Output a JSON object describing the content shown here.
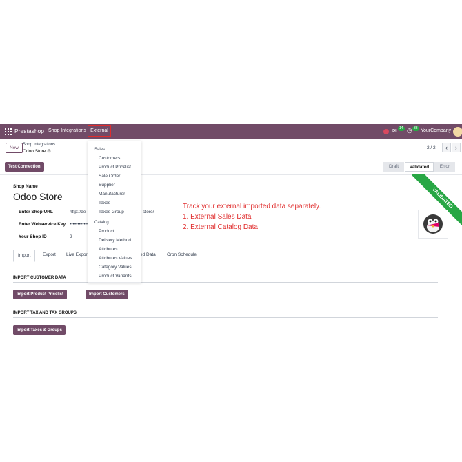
{
  "navbar": {
    "brand": "Prestashop",
    "menu_shop_integrations": "Shop Integrations",
    "menu_external": "External",
    "chat_badge": "14",
    "activity_badge": "33",
    "company": "YourCompany"
  },
  "control_panel": {
    "new_label": "New",
    "breadcrumb_parent": "Shop Integrations",
    "breadcrumb_current": "Odoo Store",
    "pager": "2 / 2"
  },
  "button_bar": {
    "test_connection": "Test Connection",
    "statuses": [
      "Draft",
      "Validated",
      "Error"
    ]
  },
  "sheet": {
    "shop_name_label": "Shop Name",
    "shop_name": "Odoo Store",
    "ribbon": "VALIDATED",
    "fields": [
      {
        "label": "Enter Shop URL",
        "value": "http://de",
        "value_tail": "-store/"
      },
      {
        "label": "Enter Webservice Key",
        "value": "••••••••••••"
      },
      {
        "label": "Your Shop ID",
        "value": "2"
      }
    ]
  },
  "annotation": {
    "line1": "Track your external imported data separately.",
    "line2": "1. External Sales Data",
    "line3": "2. External Catalog Data"
  },
  "tabs": [
    "Import",
    "Export",
    "Live Expor",
    "ed Data",
    "Cron Schedule"
  ],
  "import_section": {
    "customer_heading": "IMPORT CUSTOMER DATA",
    "btn_pricelist": "Import Product Pricelist",
    "btn_customers": "Import Customers",
    "tax_heading": "IMPORT TAX AND TAX GROUPS",
    "btn_taxes": "Import Taxes & Groups"
  },
  "dropdown": {
    "sales_heading": "Sales",
    "sales_items": [
      "Customers",
      "Product Pricelist",
      "Sale Order",
      "Supplier",
      "Manufacturer",
      "Taxes",
      "Taxes Group"
    ],
    "catalog_heading": "Catalog",
    "catalog_items": [
      "Product",
      "Delivery Method",
      "Attributes",
      "Attributes Values",
      "Category Values",
      "Product Variants"
    ]
  },
  "colors": {
    "brand": "#714b67",
    "ribbon": "#28a745",
    "annotation": "#e02d2d"
  }
}
